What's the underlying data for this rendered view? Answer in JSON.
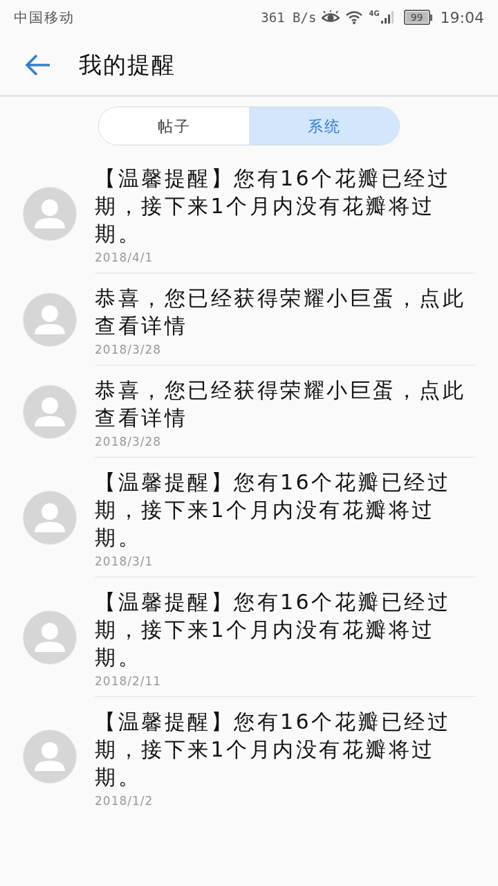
{
  "status_bar": {
    "carrier": "中国移动",
    "speed": "361 B/s",
    "network": "4G",
    "battery": "99",
    "time": "19:04"
  },
  "header": {
    "title": "我的提醒"
  },
  "tabs": [
    {
      "label": "帖子",
      "selected": false
    },
    {
      "label": "系统",
      "selected": true
    }
  ],
  "notifications": [
    {
      "text": "【温馨提醒】您有16个花瓣已经过期，接下来1个月内没有花瓣将过期。",
      "date": "2018/4/1"
    },
    {
      "text": "恭喜，您已经获得荣耀小巨蛋，点此查看详情",
      "date": "2018/3/28"
    },
    {
      "text": "恭喜，您已经获得荣耀小巨蛋，点此查看详情",
      "date": "2018/3/28"
    },
    {
      "text": "【温馨提醒】您有16个花瓣已经过期，接下来1个月内没有花瓣将过期。",
      "date": "2018/3/1"
    },
    {
      "text": "【温馨提醒】您有16个花瓣已经过期，接下来1个月内没有花瓣将过期。",
      "date": "2018/2/11"
    },
    {
      "text": "【温馨提醒】您有16个花瓣已经过期，接下来1个月内没有花瓣将过期。",
      "date": "2018/1/2"
    }
  ]
}
